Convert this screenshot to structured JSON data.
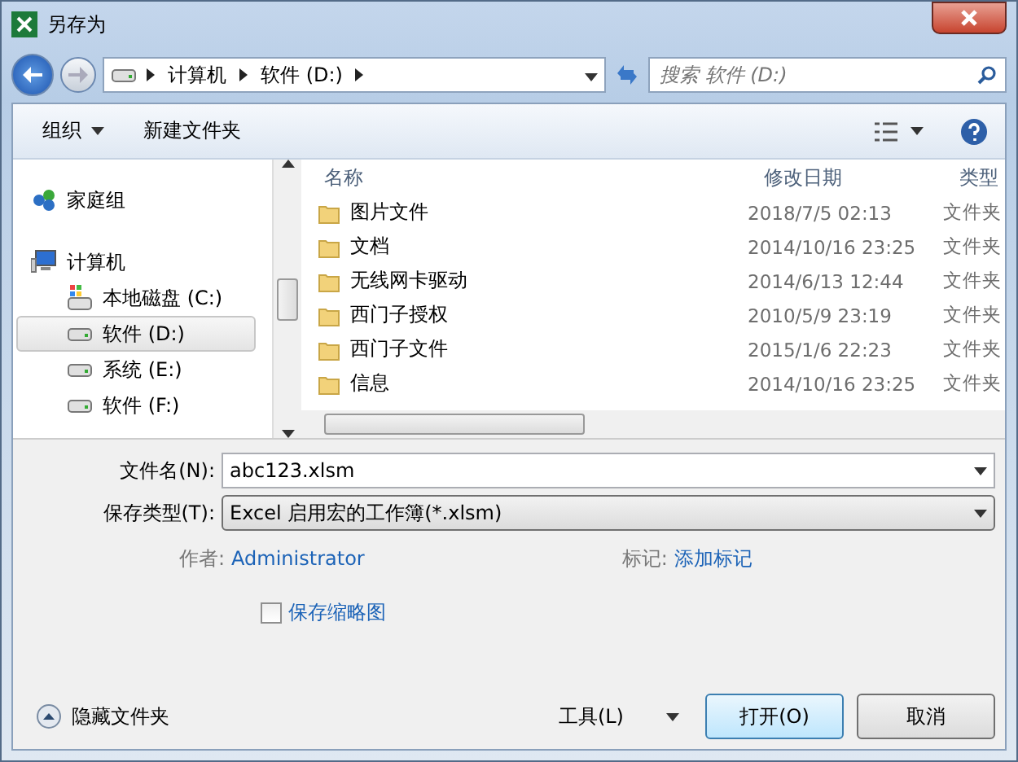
{
  "window": {
    "title": "另存为"
  },
  "address": {
    "crumbs": [
      "计算机",
      "软件 (D:)"
    ]
  },
  "search": {
    "placeholder": "搜索 软件 (D:)"
  },
  "toolbar": {
    "organize": "组织",
    "new_folder": "新建文件夹"
  },
  "sidebar": {
    "items": [
      {
        "label": "家庭组",
        "kind": "homegroup",
        "selected": false
      },
      {
        "label": "计算机",
        "kind": "computer",
        "selected": false,
        "children": [
          {
            "label": "本地磁盘 (C:)",
            "kind": "sysdrive",
            "selected": false
          },
          {
            "label": "软件 (D:)",
            "kind": "drive",
            "selected": true
          },
          {
            "label": "系统 (E:)",
            "kind": "drive",
            "selected": false
          },
          {
            "label": "软件 (F:)",
            "kind": "drive",
            "selected": false
          }
        ]
      }
    ]
  },
  "table": {
    "columns": [
      "名称",
      "修改日期",
      "类型"
    ],
    "rows": [
      {
        "name": "图片文件",
        "date": "2018/7/5 02:13",
        "type": "文件夹"
      },
      {
        "name": "文档",
        "date": "2014/10/16 23:25",
        "type": "文件夹"
      },
      {
        "name": "无线网卡驱动",
        "date": "2014/6/13 12:44",
        "type": "文件夹"
      },
      {
        "name": "西门子授权",
        "date": "2010/5/9 23:19",
        "type": "文件夹"
      },
      {
        "name": "西门子文件",
        "date": "2015/1/6 22:23",
        "type": "文件夹"
      },
      {
        "name": "信息",
        "date": "2014/10/16 23:25",
        "type": "文件夹"
      }
    ]
  },
  "form": {
    "filename_label": "文件名(N):",
    "filename": "abc123.xlsm",
    "type_label": "保存类型(T):",
    "type": "Excel 启用宏的工作簿(*.xlsm)",
    "author_label": "作者:",
    "author": "Administrator",
    "tags_label": "标记:",
    "tags": "添加标记",
    "thumbnail": {
      "label": "保存缩略图",
      "checked": false
    }
  },
  "footer": {
    "hide_folders": "隐藏文件夹",
    "tools": "工具(L)",
    "open": "打开(O)",
    "cancel": "取消"
  }
}
